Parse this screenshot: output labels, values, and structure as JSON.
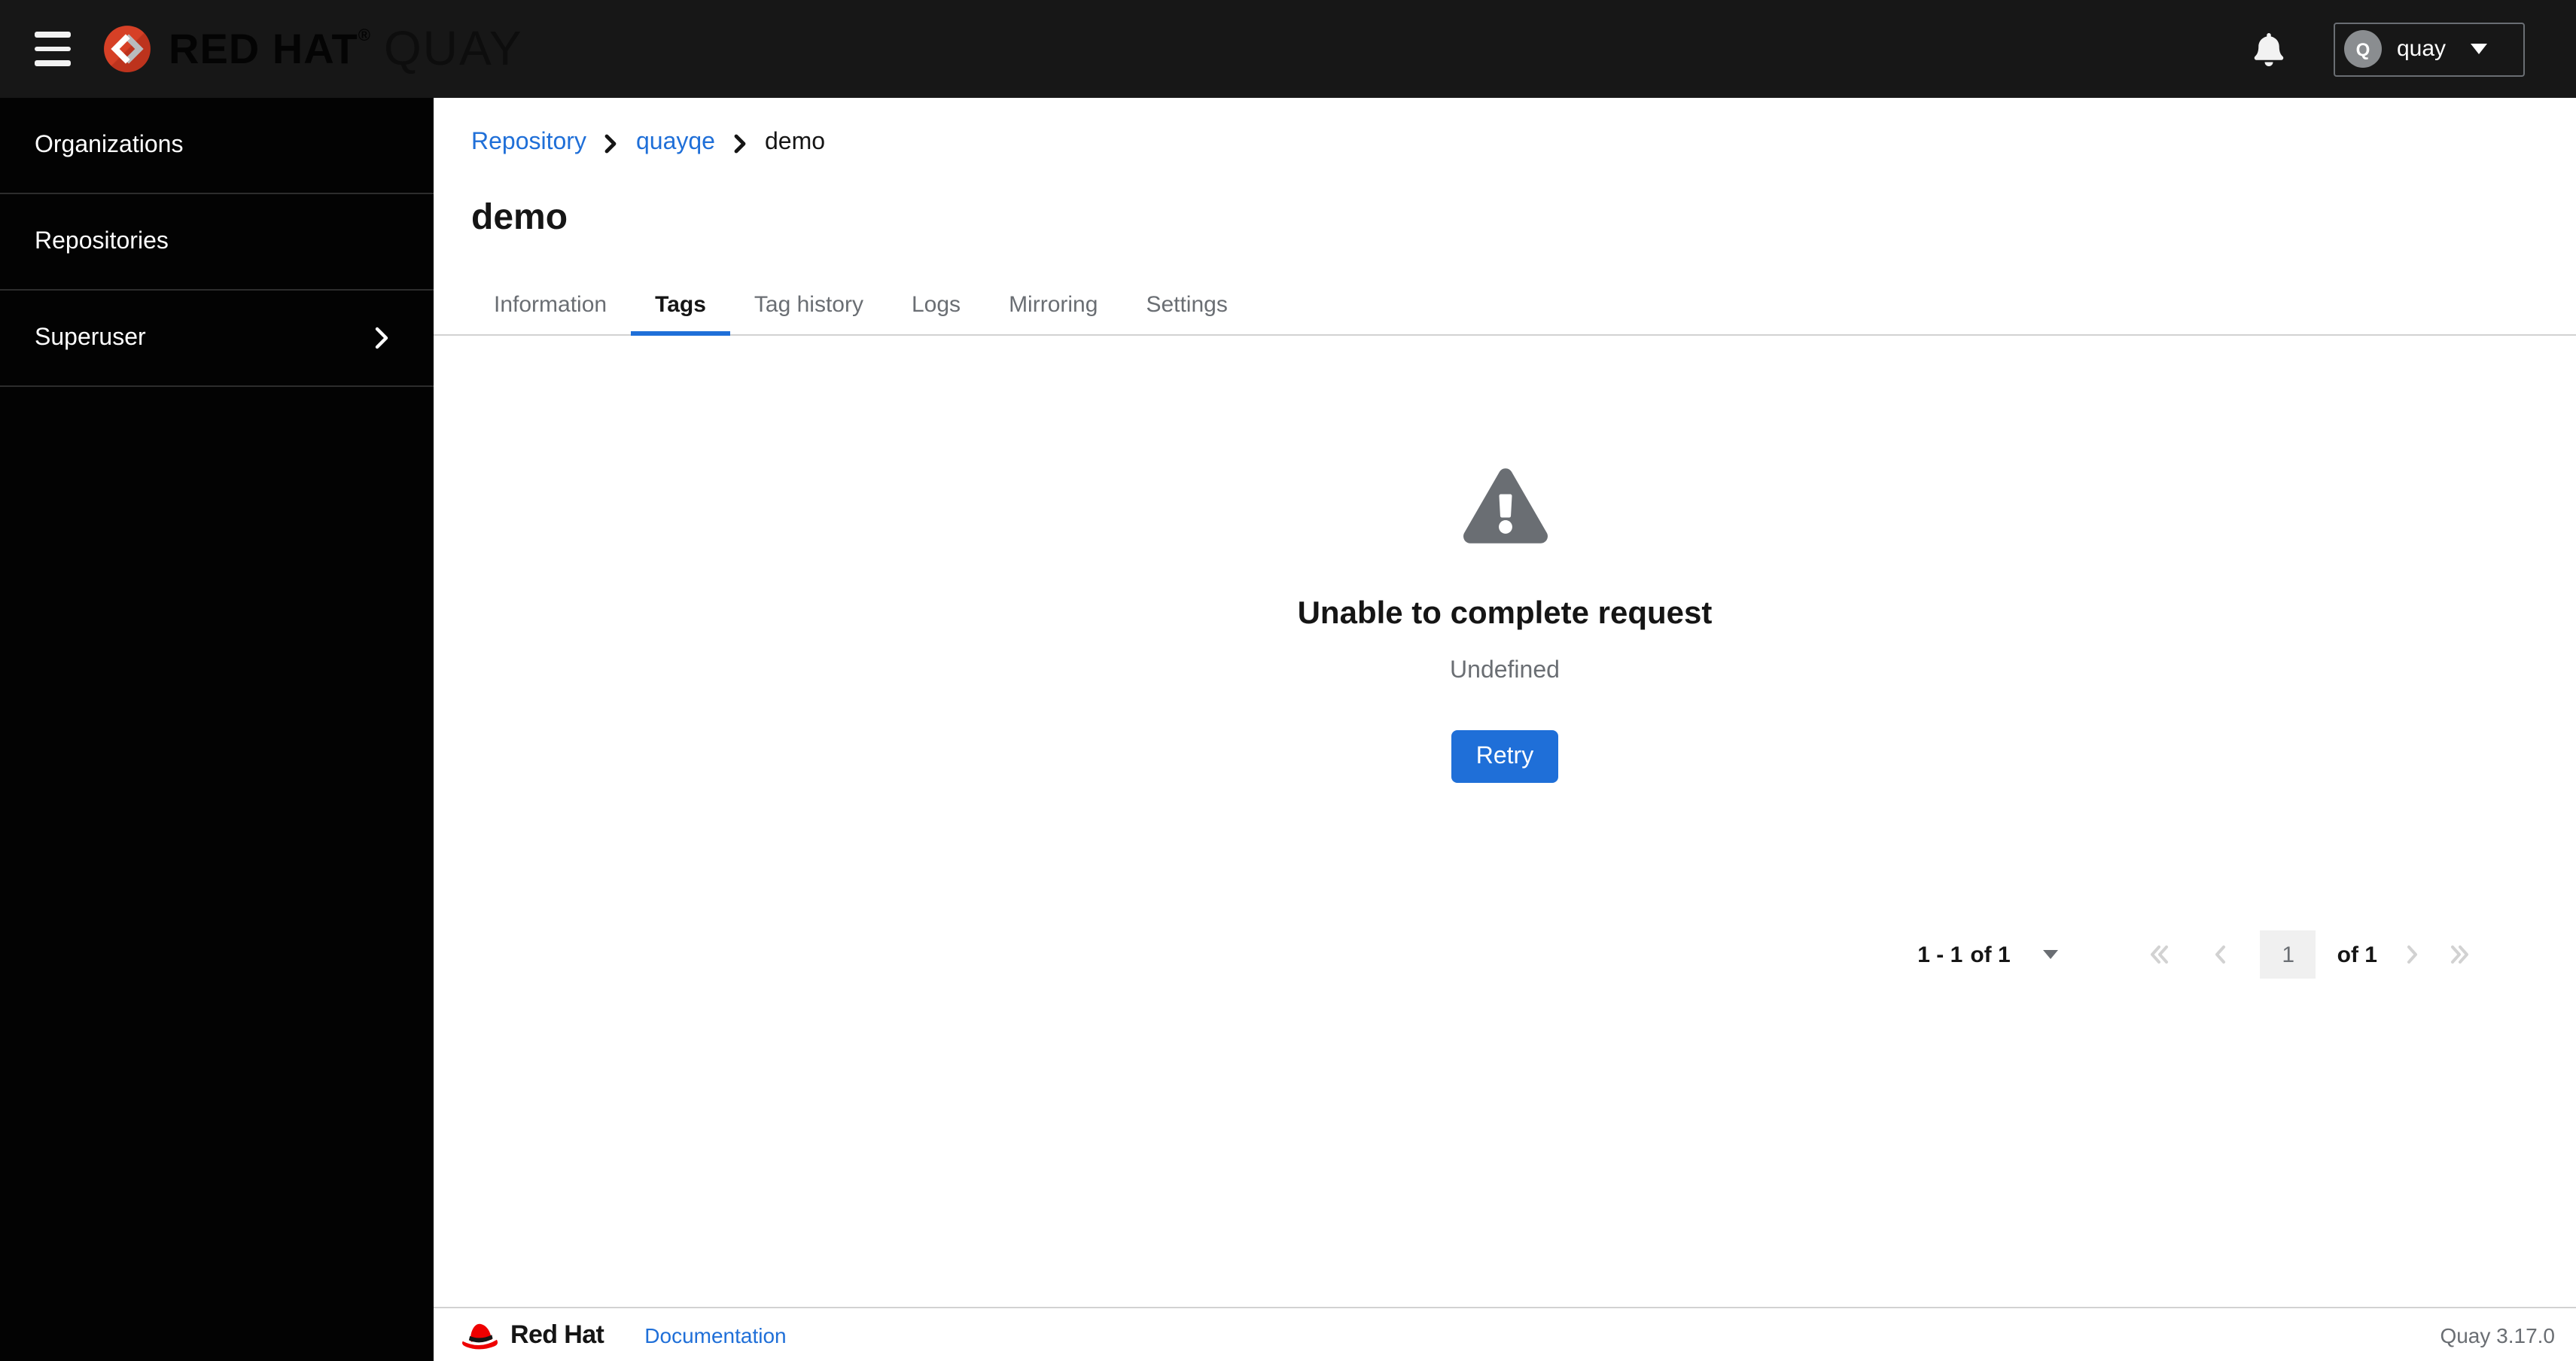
{
  "masthead": {
    "brand_primary": "RED HAT",
    "brand_reg": "®",
    "brand_product": "QUAY",
    "user": {
      "name": "quay",
      "initial": "Q"
    }
  },
  "sidebar": {
    "items": [
      {
        "label": "Organizations"
      },
      {
        "label": "Repositories"
      },
      {
        "label": "Superuser"
      }
    ]
  },
  "breadcrumb": {
    "items": [
      {
        "label": "Repository"
      },
      {
        "label": "quayqe"
      },
      {
        "label": "demo"
      }
    ]
  },
  "page": {
    "title": "demo"
  },
  "tabs": {
    "active": "Tags",
    "items": [
      {
        "label": "Information"
      },
      {
        "label": "Tags"
      },
      {
        "label": "Tag history"
      },
      {
        "label": "Logs"
      },
      {
        "label": "Mirroring"
      },
      {
        "label": "Settings"
      }
    ]
  },
  "empty_state": {
    "title": "Unable to complete request",
    "description": "Undefined",
    "action_label": "Retry"
  },
  "pagination": {
    "range": "1 - 1",
    "range_of": "of 1",
    "page_value": "1",
    "of_total": "of 1"
  },
  "footer": {
    "brand": "Red Hat",
    "doc_link": "Documentation",
    "version": "Quay 3.17.0"
  },
  "colors": {
    "accent_blue": "#1f6fd8",
    "masthead_bg": "#171717",
    "sidebar_bg": "#030303",
    "sidebar_divider": "#2d2d2d",
    "text_dark": "#151515",
    "text_gray": "#6a6e73",
    "border_gray": "#d2d2d2",
    "disabled_gray": "#d2d2d2",
    "input_bg": "#f0f0f0",
    "avatar_bg": "#8a8d90",
    "logo_red": "#d64026",
    "fedora_red": "#ee0000"
  }
}
